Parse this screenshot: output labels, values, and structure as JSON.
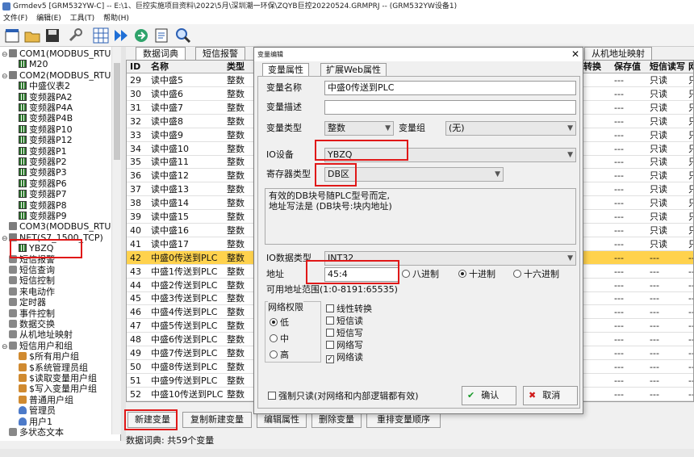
{
  "window": {
    "title": "Grmdev5 [GRM532YW-C]  -- E:\\1、巨控实施项目资料\\2022\\5月\\深圳潮一环保\\ZQYB巨控20220524.GRMPRJ -- (GRM532YW设备1)"
  },
  "menu": [
    "文件(F)",
    "编辑(E)",
    "工具(T)",
    "帮助(H)"
  ],
  "tree": {
    "items": [
      {
        "label": "COM1(MODBUS_RTU)",
        "level": 0,
        "icon": "net-icon",
        "exp": "⊖"
      },
      {
        "label": "M20",
        "level": 1,
        "icon": "device-icon",
        "exp": ""
      },
      {
        "label": "COM2(MODBUS_RTU)",
        "level": 0,
        "icon": "net-icon",
        "exp": "⊖"
      },
      {
        "label": "中盛仪表2",
        "level": 1,
        "icon": "device-icon",
        "exp": ""
      },
      {
        "label": "变频器PA2",
        "level": 1,
        "icon": "device-icon",
        "exp": ""
      },
      {
        "label": "变频器P4A",
        "level": 1,
        "icon": "device-icon",
        "exp": ""
      },
      {
        "label": "变频器P4B",
        "level": 1,
        "icon": "device-icon",
        "exp": ""
      },
      {
        "label": "变频器P10",
        "level": 1,
        "icon": "device-icon",
        "exp": ""
      },
      {
        "label": "变频器P12",
        "level": 1,
        "icon": "device-icon",
        "exp": ""
      },
      {
        "label": "变频器P1",
        "level": 1,
        "icon": "device-icon",
        "exp": ""
      },
      {
        "label": "变频器P2",
        "level": 1,
        "icon": "device-icon",
        "exp": ""
      },
      {
        "label": "变频器P3",
        "level": 1,
        "icon": "device-icon",
        "exp": ""
      },
      {
        "label": "变频器P6",
        "level": 1,
        "icon": "device-icon",
        "exp": ""
      },
      {
        "label": "变频器P7",
        "level": 1,
        "icon": "device-icon",
        "exp": ""
      },
      {
        "label": "变频器P8",
        "level": 1,
        "icon": "device-icon",
        "exp": ""
      },
      {
        "label": "变频器P9",
        "level": 1,
        "icon": "device-icon",
        "exp": ""
      },
      {
        "label": "COM3(MODBUS_RTU)",
        "level": 0,
        "icon": "net-icon",
        "exp": ""
      },
      {
        "label": "NET(S7_1500_TCP)",
        "level": 0,
        "icon": "net-icon",
        "exp": "⊖"
      },
      {
        "label": "YBZQ",
        "level": 1,
        "icon": "device-icon",
        "exp": ""
      },
      {
        "label": "短信报警",
        "level": 0,
        "icon": "misc-icon",
        "exp": ""
      },
      {
        "label": "短信查询",
        "level": 0,
        "icon": "misc-icon",
        "exp": ""
      },
      {
        "label": "短信控制",
        "level": 0,
        "icon": "misc-icon",
        "exp": ""
      },
      {
        "label": "来电动作",
        "level": 0,
        "icon": "misc-icon",
        "exp": ""
      },
      {
        "label": "定时器",
        "level": 0,
        "icon": "misc-icon",
        "exp": ""
      },
      {
        "label": "事件控制",
        "level": 0,
        "icon": "misc-icon",
        "exp": ""
      },
      {
        "label": "数据交换",
        "level": 0,
        "icon": "misc-icon",
        "exp": ""
      },
      {
        "label": "从机地址映射",
        "level": 0,
        "icon": "misc-icon",
        "exp": ""
      },
      {
        "label": "短信用户和组",
        "level": 0,
        "icon": "misc-icon",
        "exp": "⊖"
      },
      {
        "label": "$所有用户组",
        "level": 1,
        "icon": "user-icon",
        "exp": ""
      },
      {
        "label": "$系统管理员组",
        "level": 1,
        "icon": "user-icon",
        "exp": ""
      },
      {
        "label": "$读取变量用户组",
        "level": 1,
        "icon": "user-icon",
        "exp": ""
      },
      {
        "label": "$写入变量用户组",
        "level": 1,
        "icon": "user-icon",
        "exp": ""
      },
      {
        "label": "普通用户组",
        "level": 1,
        "icon": "user-icon",
        "exp": ""
      },
      {
        "label": "管理员",
        "level": 1,
        "icon": "person-icon",
        "exp": ""
      },
      {
        "label": "用户1",
        "level": 1,
        "icon": "person-icon",
        "exp": ""
      },
      {
        "label": "多状态文本",
        "level": 0,
        "icon": "misc-icon",
        "exp": ""
      }
    ]
  },
  "tabs": [
    "数据词典",
    "短信报警",
    "从机地址映射"
  ],
  "grid": {
    "headers": {
      "id": "ID",
      "name": "名称",
      "type": "类型",
      "convert": "转换",
      "keep": "保存值",
      "sms": "短信读写",
      "net": "网"
    },
    "rows": [
      {
        "id": "29",
        "name": "读中盛5",
        "type": "整数",
        "keep": "---",
        "sms": "只读",
        "net": "只"
      },
      {
        "id": "30",
        "name": "读中盛6",
        "type": "整数",
        "keep": "---",
        "sms": "只读",
        "net": "只"
      },
      {
        "id": "31",
        "name": "读中盛7",
        "type": "整数",
        "keep": "---",
        "sms": "只读",
        "net": "只"
      },
      {
        "id": "32",
        "name": "读中盛8",
        "type": "整数",
        "keep": "---",
        "sms": "只读",
        "net": "只"
      },
      {
        "id": "33",
        "name": "读中盛9",
        "type": "整数",
        "keep": "---",
        "sms": "只读",
        "net": "只"
      },
      {
        "id": "34",
        "name": "读中盛10",
        "type": "整数",
        "keep": "---",
        "sms": "只读",
        "net": "只"
      },
      {
        "id": "35",
        "name": "读中盛11",
        "type": "整数",
        "keep": "---",
        "sms": "只读",
        "net": "只"
      },
      {
        "id": "36",
        "name": "读中盛12",
        "type": "整数",
        "keep": "---",
        "sms": "只读",
        "net": "只"
      },
      {
        "id": "37",
        "name": "读中盛13",
        "type": "整数",
        "keep": "---",
        "sms": "只读",
        "net": "只"
      },
      {
        "id": "38",
        "name": "读中盛14",
        "type": "整数",
        "keep": "---",
        "sms": "只读",
        "net": "只"
      },
      {
        "id": "39",
        "name": "读中盛15",
        "type": "整数",
        "keep": "---",
        "sms": "只读",
        "net": "只"
      },
      {
        "id": "40",
        "name": "读中盛16",
        "type": "整数",
        "keep": "---",
        "sms": "只读",
        "net": "只"
      },
      {
        "id": "41",
        "name": "读中盛17",
        "type": "整数",
        "keep": "---",
        "sms": "只读",
        "net": "只"
      },
      {
        "id": "42",
        "name": "中盛0传送到PLC",
        "type": "整数",
        "keep": "---",
        "sms": "---",
        "net": "---"
      },
      {
        "id": "43",
        "name": "中盛1传送到PLC",
        "type": "整数",
        "keep": "---",
        "sms": "---",
        "net": "---"
      },
      {
        "id": "44",
        "name": "中盛2传送到PLC",
        "type": "整数",
        "keep": "---",
        "sms": "---",
        "net": "---"
      },
      {
        "id": "45",
        "name": "中盛3传送到PLC",
        "type": "整数",
        "keep": "---",
        "sms": "---",
        "net": "---"
      },
      {
        "id": "46",
        "name": "中盛4传送到PLC",
        "type": "整数",
        "keep": "---",
        "sms": "---",
        "net": "---"
      },
      {
        "id": "47",
        "name": "中盛5传送到PLC",
        "type": "整数",
        "keep": "---",
        "sms": "---",
        "net": "---"
      },
      {
        "id": "48",
        "name": "中盛6传送到PLC",
        "type": "整数",
        "keep": "---",
        "sms": "---",
        "net": "---"
      },
      {
        "id": "49",
        "name": "中盛7传送到PLC",
        "type": "整数",
        "keep": "---",
        "sms": "---",
        "net": "---"
      },
      {
        "id": "50",
        "name": "中盛8传送到PLC",
        "type": "整数",
        "keep": "---",
        "sms": "---",
        "net": "---"
      },
      {
        "id": "51",
        "name": "中盛9传送到PLC",
        "type": "整数",
        "keep": "---",
        "sms": "---",
        "net": "---"
      },
      {
        "id": "52",
        "name": "中盛10传送到PLC",
        "type": "整数",
        "keep": "---",
        "sms": "---",
        "net": "---"
      },
      {
        "id": "53",
        "name": "中盛11传送到PLC",
        "type": "整数",
        "keep": "---",
        "sms": "---",
        "net": "---"
      }
    ],
    "selected_id": "42"
  },
  "buttons": [
    "新建变量",
    "复制新建变量",
    "编辑属性",
    "删除变量",
    "重排变量顺序"
  ],
  "status": "数据词典: 共59个变量",
  "dialog": {
    "title": "变量编辑",
    "tabs": [
      "变量属性",
      "扩展Web属性"
    ],
    "name_label": "变量名称",
    "name_value": "中盛0传送到PLC",
    "desc_label": "变量描述",
    "desc_value": "",
    "type_label": "变量类型",
    "type_value": "整数",
    "group_label": "变量组",
    "group_value": "(无)",
    "io_label": "IO设备",
    "io_value": "YBZQ",
    "reg_label": "寄存器类型",
    "reg_value": "DB区",
    "hint_line1": "有效的DB块号随PLC型号而定,",
    "hint_line2": "地址写法是 (DB块号:块内地址)",
    "iotype_label": "IO数据类型",
    "iotype_value": "INT32",
    "addr_label": "地址",
    "addr_value": "45:4",
    "radix_oct": "八进制",
    "radix_dec": "十进制",
    "radix_hex": "十六进制",
    "range_label": "可用地址范围(1:0-8191:65535)",
    "perm_label": "网络权限",
    "perm_low": "低",
    "perm_mid": "中",
    "perm_high": "高",
    "chk_linear": "线性转换",
    "chk_sms_read": "短信读",
    "chk_sms_write": "短信写",
    "chk_net_write": "网络写",
    "chk_net_read": "网络读",
    "force_ro": "强制只读(对网络和内部逻辑都有效)",
    "ok": "确认",
    "cancel": "取消"
  },
  "colors": {
    "selected_row": "#ffd24d",
    "highlight": "#e01818"
  }
}
